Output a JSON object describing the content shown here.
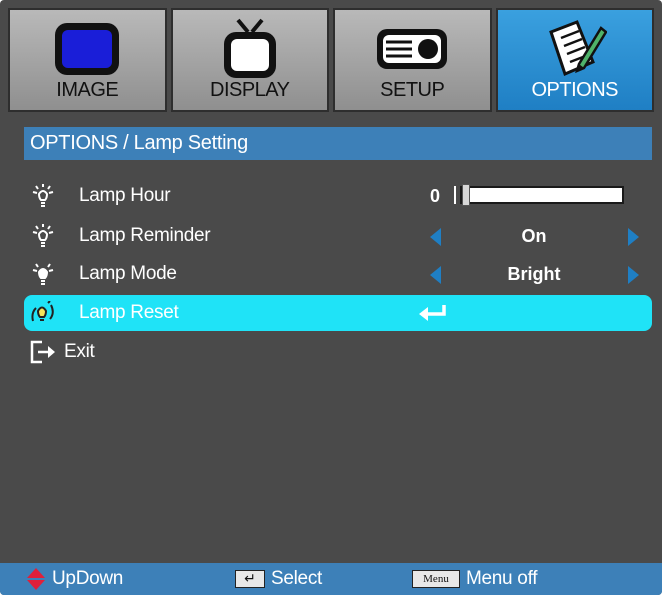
{
  "tabs": [
    {
      "label": "IMAGE",
      "icon": "monitor-icon",
      "active": false
    },
    {
      "label": "DISPLAY",
      "icon": "tv-icon",
      "active": false
    },
    {
      "label": "SETUP",
      "icon": "projector-icon",
      "active": false
    },
    {
      "label": "OPTIONS",
      "icon": "notepad-pencil-icon",
      "active": true
    }
  ],
  "title": "OPTIONS / Lamp Setting",
  "menu": [
    {
      "label": "Lamp Hour",
      "icon": "lamp-icon",
      "value": "0",
      "slider_fraction": 0.0
    },
    {
      "label": "Lamp Reminder",
      "icon": "lamp-icon",
      "value": "On"
    },
    {
      "label": "Lamp Mode",
      "icon": "lamp-icon",
      "value": "Bright"
    },
    {
      "label": "Lamp Reset",
      "icon": "lamp-reset-icon",
      "value_icon": "enter-icon",
      "selected": true
    },
    {
      "label": "Exit",
      "icon": "exit-icon"
    }
  ],
  "footer": {
    "updown": "UpDown",
    "select_key": "↵",
    "select": "Select",
    "menu_key": "Menu",
    "menu_off": "Menu off"
  },
  "colors": {
    "background": "#4a4a4a",
    "accent": "#3d80b8",
    "active_tab": "#1f7fc4",
    "selected_row": "#1fe3f7",
    "arrow": "#1f7fc4",
    "updown_icon": "#e0203a"
  }
}
